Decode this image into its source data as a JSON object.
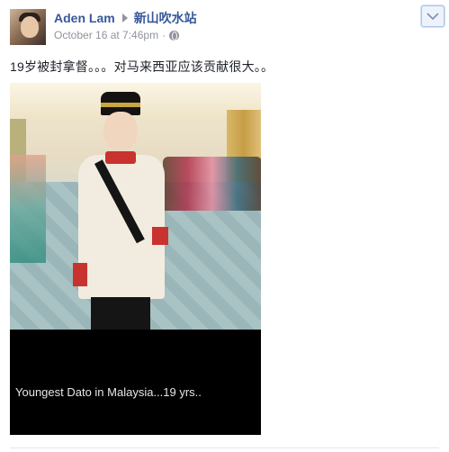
{
  "post": {
    "author": "Aden Lam",
    "page": "新山吹水站",
    "timestamp": "October 16 at 7:46pm",
    "separator": "·",
    "privacy_icon": "globe-icon",
    "menu_icon": "chevron-down-icon",
    "text": "19岁被封拿督。。。对马来西亚应该贡献很大。。",
    "photo": {
      "caption": "Youngest  Dato in Malaysia...19 yrs.."
    }
  },
  "colors": {
    "link": "#365899",
    "meta": "#90949c",
    "text": "#1d2129",
    "chevron_border": "#a9c4ee"
  }
}
